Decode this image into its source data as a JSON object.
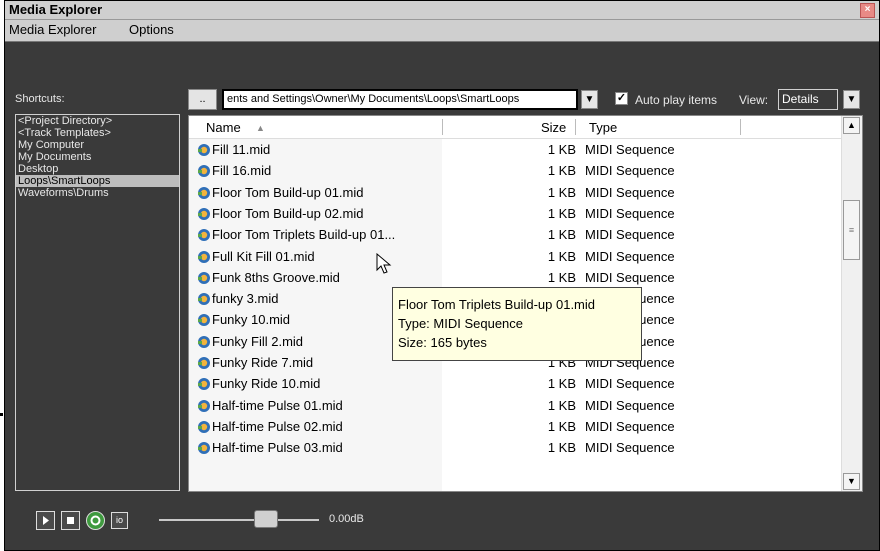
{
  "window": {
    "title": "Media Explorer",
    "close_glyph": "×"
  },
  "menu": {
    "items": [
      "Media Explorer",
      "Options"
    ]
  },
  "toolbar": {
    "shortcuts_label": "Shortcuts:",
    "browse_label": "..",
    "path": "ents and Settings\\Owner\\My Documents\\Loops\\SmartLoops",
    "autoplay_label": "Auto play items",
    "autoplay_checked": true,
    "view_label": "View:",
    "view_value": "Details"
  },
  "shortcuts": {
    "items": [
      "<Project Directory>",
      "<Track Templates>",
      "My Computer",
      "My Documents",
      "Desktop",
      "Loops\\SmartLoops",
      "Waveforms\\Drums"
    ],
    "selected": "Loops\\SmartLoops"
  },
  "columns": {
    "name": "Name",
    "size": "Size",
    "type": "Type"
  },
  "files": [
    {
      "name": "Fill 11.mid",
      "size": "1 KB",
      "type": "MIDI Sequence"
    },
    {
      "name": "Fill 16.mid",
      "size": "1 KB",
      "type": "MIDI Sequence"
    },
    {
      "name": "Floor Tom Build-up 01.mid",
      "size": "1 KB",
      "type": "MIDI Sequence"
    },
    {
      "name": "Floor Tom Build-up 02.mid",
      "size": "1 KB",
      "type": "MIDI Sequence"
    },
    {
      "name": "Floor Tom Triplets Build-up 01...",
      "size": "1 KB",
      "type": "MIDI Sequence"
    },
    {
      "name": "Full Kit Fill 01.mid",
      "size": "1 KB",
      "type": "MIDI Sequence"
    },
    {
      "name": "Funk 8ths Groove.mid",
      "size": "1 KB",
      "type": "MIDI Sequence"
    },
    {
      "name": "funky 3.mid",
      "size": "1 KB",
      "type": "MIDI Sequence"
    },
    {
      "name": "Funky 10.mid",
      "size": "1 KB",
      "type": "MIDI Sequence"
    },
    {
      "name": "Funky Fill 2.mid",
      "size": "1 KB",
      "type": "MIDI Sequence"
    },
    {
      "name": "Funky Ride 7.mid",
      "size": "1 KB",
      "type": "MIDI Sequence"
    },
    {
      "name": "Funky Ride 10.mid",
      "size": "1 KB",
      "type": "MIDI Sequence"
    },
    {
      "name": "Half-time Pulse 01.mid",
      "size": "1 KB",
      "type": "MIDI Sequence"
    },
    {
      "name": "Half-time Pulse 02.mid",
      "size": "1 KB",
      "type": "MIDI Sequence"
    },
    {
      "name": "Half-time Pulse 03.mid",
      "size": "1 KB",
      "type": "MIDI Sequence"
    }
  ],
  "tooltip": {
    "title": "Floor Tom Triplets Build-up 01.mid",
    "type_line": "Type: MIDI Sequence",
    "size_line": "Size: 165 bytes"
  },
  "transport": {
    "volume": "0.00dB",
    "io_label": "io",
    "buttons": [
      "play-icon",
      "stop-icon",
      "loop-icon"
    ]
  },
  "colors": {
    "background": "#3a3a3a",
    "titlebar": "#cfcfcf",
    "tooltip": "#ffffe1",
    "loop_button": "#3f9a3f"
  }
}
